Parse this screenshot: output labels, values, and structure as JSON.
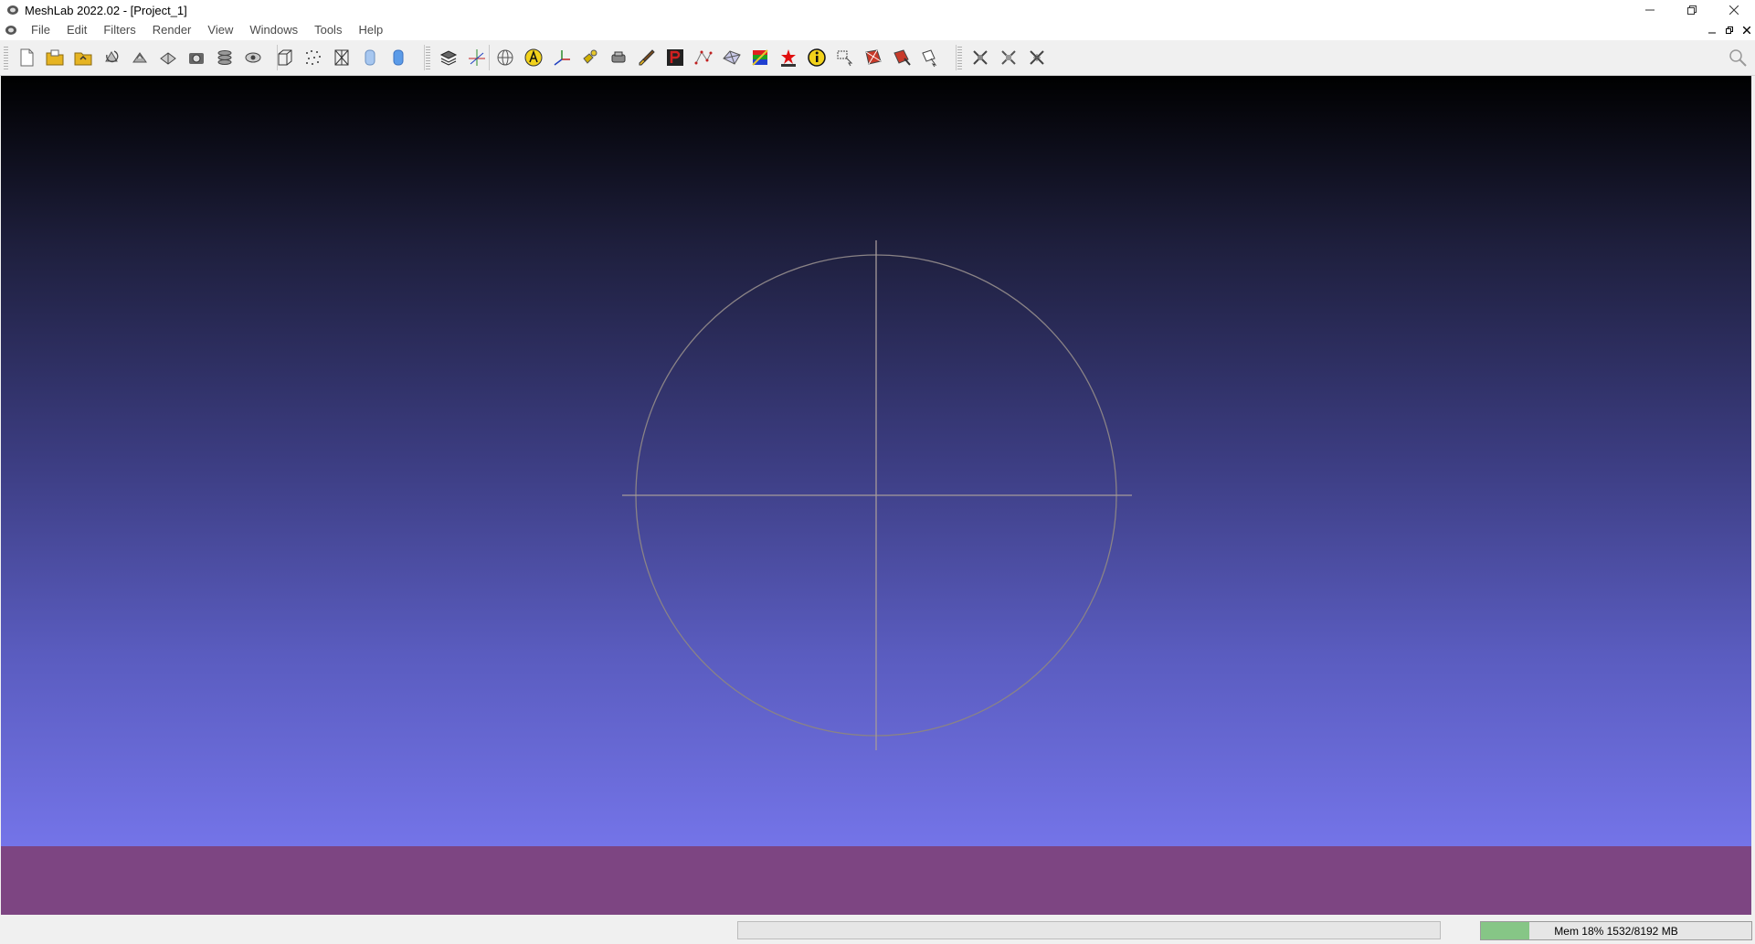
{
  "window": {
    "title": "MeshLab 2022.02 - [Project_1]",
    "controls": [
      "minimize",
      "restore",
      "close"
    ]
  },
  "menubar": {
    "items": [
      "File",
      "Edit",
      "Filters",
      "Render",
      "View",
      "Windows",
      "Tools",
      "Help"
    ]
  },
  "toolbar": {
    "groups": [
      [
        "new-project-icon",
        "open-project-icon",
        "import-mesh-icon",
        "reload-icon",
        "reload-all-icon",
        "export-mesh-icon",
        "snapshot-icon",
        "layer-stack-icon",
        "ortho-view-icon"
      ],
      [
        "bounding-box-icon",
        "points-icon",
        "wireframe-icon",
        "flat-icon",
        "smooth-icon"
      ],
      [
        "layers-icon",
        "decorate-axes-icon"
      ],
      [
        "trackball-icon",
        "annotation-icon",
        "measure-icon",
        "paint-icon",
        "align-icon",
        "brush-icon",
        "pick-points-icon",
        "select-vertices-icon",
        "select-faces-icon",
        "texture-icon",
        "georef-icon",
        "info-icon",
        "select-connected-icon",
        "select-area-icon",
        "select-brush-icon",
        "select-polygon-icon"
      ],
      [
        "tool-a-icon",
        "tool-b-icon",
        "tool-c-icon"
      ]
    ]
  },
  "search": {
    "icon": "search-icon"
  },
  "statusbar": {
    "memory_label": "Mem 18% 1532/8192 MB",
    "memory_fraction": 0.18
  },
  "colors": {
    "viewport_top": "#000000",
    "viewport_bottom": "#7474e8",
    "floor_band": "#7d4582",
    "memory_fill": "#86c686",
    "trackball": "#9a8f8f"
  }
}
